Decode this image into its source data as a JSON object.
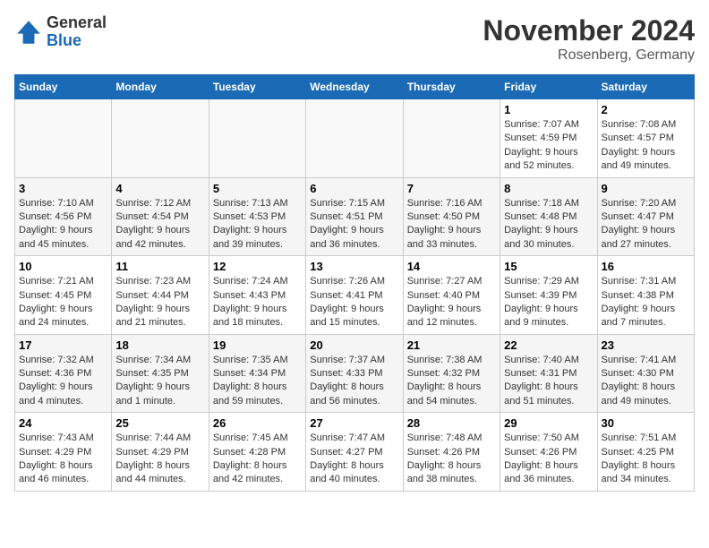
{
  "header": {
    "logo_general": "General",
    "logo_blue": "Blue",
    "month_title": "November 2024",
    "location": "Rosenberg, Germany"
  },
  "days_of_week": [
    "Sunday",
    "Monday",
    "Tuesday",
    "Wednesday",
    "Thursday",
    "Friday",
    "Saturday"
  ],
  "weeks": [
    [
      {
        "day": "",
        "empty": true
      },
      {
        "day": "",
        "empty": true
      },
      {
        "day": "",
        "empty": true
      },
      {
        "day": "",
        "empty": true
      },
      {
        "day": "",
        "empty": true
      },
      {
        "day": "1",
        "sunrise": "Sunrise: 7:07 AM",
        "sunset": "Sunset: 4:59 PM",
        "daylight": "Daylight: 9 hours and 52 minutes."
      },
      {
        "day": "2",
        "sunrise": "Sunrise: 7:08 AM",
        "sunset": "Sunset: 4:57 PM",
        "daylight": "Daylight: 9 hours and 49 minutes."
      }
    ],
    [
      {
        "day": "3",
        "sunrise": "Sunrise: 7:10 AM",
        "sunset": "Sunset: 4:56 PM",
        "daylight": "Daylight: 9 hours and 45 minutes."
      },
      {
        "day": "4",
        "sunrise": "Sunrise: 7:12 AM",
        "sunset": "Sunset: 4:54 PM",
        "daylight": "Daylight: 9 hours and 42 minutes."
      },
      {
        "day": "5",
        "sunrise": "Sunrise: 7:13 AM",
        "sunset": "Sunset: 4:53 PM",
        "daylight": "Daylight: 9 hours and 39 minutes."
      },
      {
        "day": "6",
        "sunrise": "Sunrise: 7:15 AM",
        "sunset": "Sunset: 4:51 PM",
        "daylight": "Daylight: 9 hours and 36 minutes."
      },
      {
        "day": "7",
        "sunrise": "Sunrise: 7:16 AM",
        "sunset": "Sunset: 4:50 PM",
        "daylight": "Daylight: 9 hours and 33 minutes."
      },
      {
        "day": "8",
        "sunrise": "Sunrise: 7:18 AM",
        "sunset": "Sunset: 4:48 PM",
        "daylight": "Daylight: 9 hours and 30 minutes."
      },
      {
        "day": "9",
        "sunrise": "Sunrise: 7:20 AM",
        "sunset": "Sunset: 4:47 PM",
        "daylight": "Daylight: 9 hours and 27 minutes."
      }
    ],
    [
      {
        "day": "10",
        "sunrise": "Sunrise: 7:21 AM",
        "sunset": "Sunset: 4:45 PM",
        "daylight": "Daylight: 9 hours and 24 minutes."
      },
      {
        "day": "11",
        "sunrise": "Sunrise: 7:23 AM",
        "sunset": "Sunset: 4:44 PM",
        "daylight": "Daylight: 9 hours and 21 minutes."
      },
      {
        "day": "12",
        "sunrise": "Sunrise: 7:24 AM",
        "sunset": "Sunset: 4:43 PM",
        "daylight": "Daylight: 9 hours and 18 minutes."
      },
      {
        "day": "13",
        "sunrise": "Sunrise: 7:26 AM",
        "sunset": "Sunset: 4:41 PM",
        "daylight": "Daylight: 9 hours and 15 minutes."
      },
      {
        "day": "14",
        "sunrise": "Sunrise: 7:27 AM",
        "sunset": "Sunset: 4:40 PM",
        "daylight": "Daylight: 9 hours and 12 minutes."
      },
      {
        "day": "15",
        "sunrise": "Sunrise: 7:29 AM",
        "sunset": "Sunset: 4:39 PM",
        "daylight": "Daylight: 9 hours and 9 minutes."
      },
      {
        "day": "16",
        "sunrise": "Sunrise: 7:31 AM",
        "sunset": "Sunset: 4:38 PM",
        "daylight": "Daylight: 9 hours and 7 minutes."
      }
    ],
    [
      {
        "day": "17",
        "sunrise": "Sunrise: 7:32 AM",
        "sunset": "Sunset: 4:36 PM",
        "daylight": "Daylight: 9 hours and 4 minutes."
      },
      {
        "day": "18",
        "sunrise": "Sunrise: 7:34 AM",
        "sunset": "Sunset: 4:35 PM",
        "daylight": "Daylight: 9 hours and 1 minute."
      },
      {
        "day": "19",
        "sunrise": "Sunrise: 7:35 AM",
        "sunset": "Sunset: 4:34 PM",
        "daylight": "Daylight: 8 hours and 59 minutes."
      },
      {
        "day": "20",
        "sunrise": "Sunrise: 7:37 AM",
        "sunset": "Sunset: 4:33 PM",
        "daylight": "Daylight: 8 hours and 56 minutes."
      },
      {
        "day": "21",
        "sunrise": "Sunrise: 7:38 AM",
        "sunset": "Sunset: 4:32 PM",
        "daylight": "Daylight: 8 hours and 54 minutes."
      },
      {
        "day": "22",
        "sunrise": "Sunrise: 7:40 AM",
        "sunset": "Sunset: 4:31 PM",
        "daylight": "Daylight: 8 hours and 51 minutes."
      },
      {
        "day": "23",
        "sunrise": "Sunrise: 7:41 AM",
        "sunset": "Sunset: 4:30 PM",
        "daylight": "Daylight: 8 hours and 49 minutes."
      }
    ],
    [
      {
        "day": "24",
        "sunrise": "Sunrise: 7:43 AM",
        "sunset": "Sunset: 4:29 PM",
        "daylight": "Daylight: 8 hours and 46 minutes."
      },
      {
        "day": "25",
        "sunrise": "Sunrise: 7:44 AM",
        "sunset": "Sunset: 4:29 PM",
        "daylight": "Daylight: 8 hours and 44 minutes."
      },
      {
        "day": "26",
        "sunrise": "Sunrise: 7:45 AM",
        "sunset": "Sunset: 4:28 PM",
        "daylight": "Daylight: 8 hours and 42 minutes."
      },
      {
        "day": "27",
        "sunrise": "Sunrise: 7:47 AM",
        "sunset": "Sunset: 4:27 PM",
        "daylight": "Daylight: 8 hours and 40 minutes."
      },
      {
        "day": "28",
        "sunrise": "Sunrise: 7:48 AM",
        "sunset": "Sunset: 4:26 PM",
        "daylight": "Daylight: 8 hours and 38 minutes."
      },
      {
        "day": "29",
        "sunrise": "Sunrise: 7:50 AM",
        "sunset": "Sunset: 4:26 PM",
        "daylight": "Daylight: 8 hours and 36 minutes."
      },
      {
        "day": "30",
        "sunrise": "Sunrise: 7:51 AM",
        "sunset": "Sunset: 4:25 PM",
        "daylight": "Daylight: 8 hours and 34 minutes."
      }
    ]
  ]
}
